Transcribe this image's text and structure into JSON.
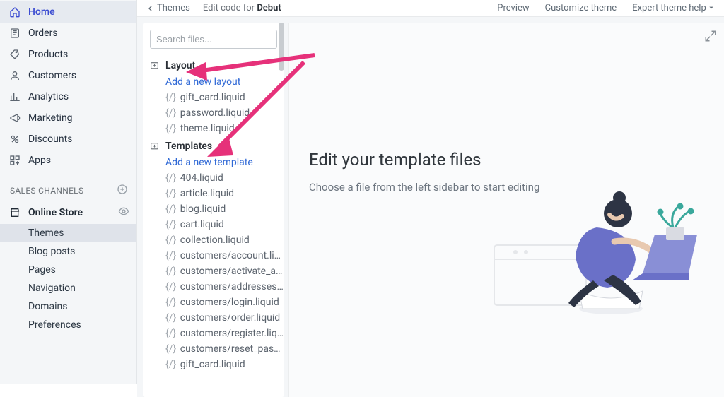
{
  "nav": {
    "items": [
      {
        "label": "Home",
        "icon": "home"
      },
      {
        "label": "Orders",
        "icon": "orders"
      },
      {
        "label": "Products",
        "icon": "products"
      },
      {
        "label": "Customers",
        "icon": "customers"
      },
      {
        "label": "Analytics",
        "icon": "analytics"
      },
      {
        "label": "Marketing",
        "icon": "marketing"
      },
      {
        "label": "Discounts",
        "icon": "discounts"
      },
      {
        "label": "Apps",
        "icon": "apps"
      }
    ],
    "sales_channels_label": "SALES CHANNELS",
    "channel": "Online Store",
    "subnav": [
      {
        "label": "Themes",
        "selected": true
      },
      {
        "label": "Blog posts"
      },
      {
        "label": "Pages"
      },
      {
        "label": "Navigation"
      },
      {
        "label": "Domains"
      },
      {
        "label": "Preferences"
      }
    ]
  },
  "topbar": {
    "back": "Themes",
    "title_prefix": "Edit code for ",
    "title_theme": "Debut",
    "actions": {
      "preview": "Preview",
      "customize": "Customize theme",
      "expert": "Expert theme help"
    }
  },
  "filetree": {
    "search_placeholder": "Search files...",
    "groups": [
      {
        "name": "Layout",
        "add_link": "Add a new layout",
        "files": [
          "gift_card.liquid",
          "password.liquid",
          "theme.liquid"
        ]
      },
      {
        "name": "Templates",
        "add_link": "Add a new template",
        "files": [
          "404.liquid",
          "article.liquid",
          "blog.liquid",
          "cart.liquid",
          "collection.liquid",
          "customers/account.liquid",
          "customers/activate_account.liquid",
          "customers/addresses.liquid",
          "customers/login.liquid",
          "customers/order.liquid",
          "customers/register.liquid",
          "customers/reset_password.liquid",
          "gift_card.liquid"
        ]
      }
    ]
  },
  "editor": {
    "heading": "Edit your template files",
    "subtext": "Choose a file from the left sidebar to start editing"
  }
}
